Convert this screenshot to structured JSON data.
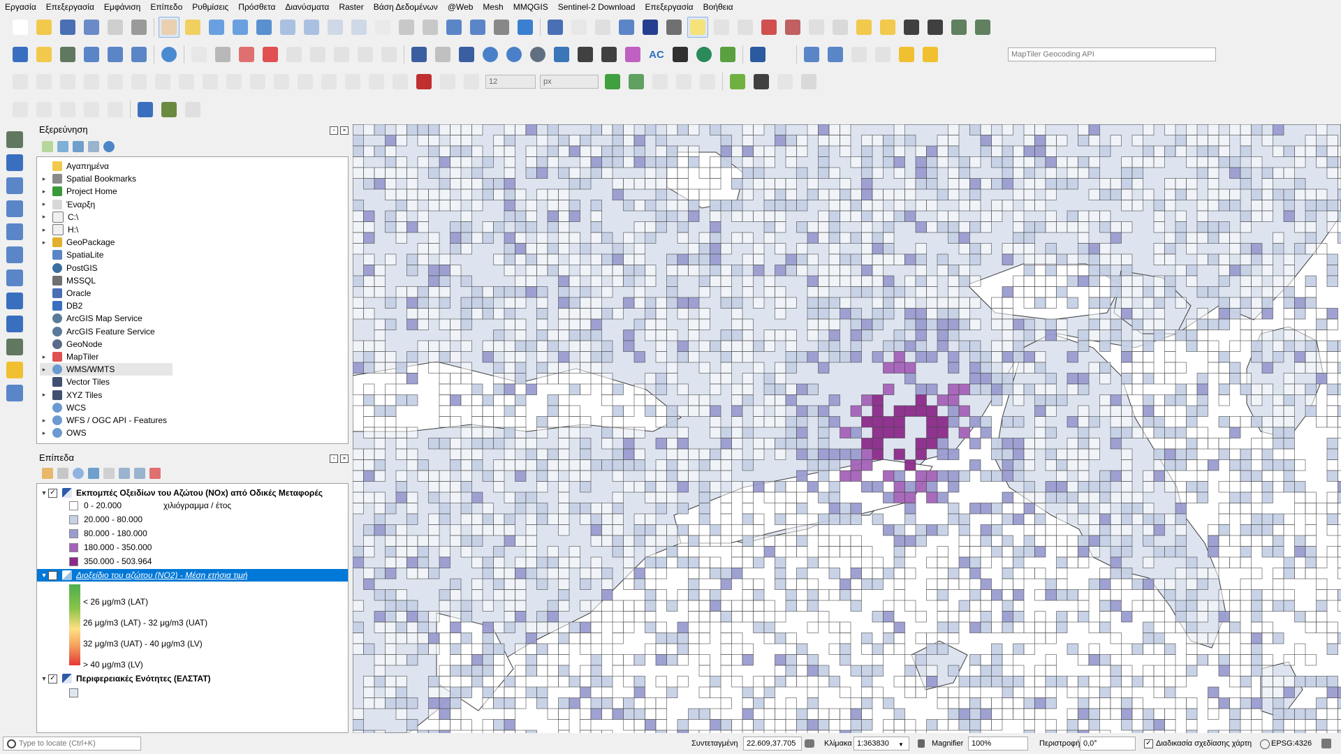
{
  "menu": [
    "Εργασία",
    "Επεξεργασία",
    "Εμφάνιση",
    "Επίπεδο",
    "Ρυθμίσεις",
    "Πρόσθετα",
    "Διανύσματα",
    "Raster",
    "Βάση Δεδομένων",
    "@Web",
    "Mesh",
    "MMQGIS",
    "Sentinel-2 Download",
    "Επεξεργασία",
    "Βοήθεια"
  ],
  "toolbar": {
    "geocoder_placeholder": "MapTiler Geocoding API",
    "font_size_value": "12",
    "font_unit_value": "px",
    "ac_label": "AC"
  },
  "browser": {
    "title": "Εξερεύνηση",
    "items": [
      {
        "label": "Αγαπημένα",
        "icon": "star-icon",
        "expand": false
      },
      {
        "label": "Spatial Bookmarks",
        "icon": "bookmark-icon",
        "expand": true
      },
      {
        "label": "Project Home",
        "icon": "home-folder-icon",
        "expand": true
      },
      {
        "label": "Έναρξη",
        "icon": "home-icon",
        "expand": true
      },
      {
        "label": "C:\\",
        "icon": "drive-icon",
        "expand": true
      },
      {
        "label": "H:\\",
        "icon": "drive-icon",
        "expand": true
      },
      {
        "label": "GeoPackage",
        "icon": "geopackage-icon",
        "expand": true
      },
      {
        "label": "SpatiaLite",
        "icon": "spatialite-icon",
        "expand": false
      },
      {
        "label": "PostGIS",
        "icon": "postgis-icon",
        "expand": false
      },
      {
        "label": "MSSQL",
        "icon": "mssql-icon",
        "expand": false
      },
      {
        "label": "Oracle",
        "icon": "oracle-icon",
        "expand": false
      },
      {
        "label": "DB2",
        "icon": "db2-icon",
        "expand": false
      },
      {
        "label": "ArcGIS Map Service",
        "icon": "arcgis-map-icon",
        "expand": false
      },
      {
        "label": "ArcGIS Feature Service",
        "icon": "arcgis-feature-icon",
        "expand": false
      },
      {
        "label": "GeoNode",
        "icon": "geonode-icon",
        "expand": false
      },
      {
        "label": "MapTiler",
        "icon": "maptiler-icon",
        "expand": true
      },
      {
        "label": "WMS/WMTS",
        "icon": "globe-icon",
        "expand": true
      },
      {
        "label": "Vector Tiles",
        "icon": "grid-icon",
        "expand": false
      },
      {
        "label": "XYZ Tiles",
        "icon": "grid-icon",
        "expand": true
      },
      {
        "label": "WCS",
        "icon": "globe-icon",
        "expand": false
      },
      {
        "label": "WFS / OGC API - Features",
        "icon": "globe-icon",
        "expand": true
      },
      {
        "label": "OWS",
        "icon": "globe-icon",
        "expand": true
      }
    ]
  },
  "layers": {
    "title": "Επίπεδα",
    "nox_layer": {
      "name": "Εκπομπές Οξειδίων του Αζώτου (NOx) από Οδικές Μεταφορές",
      "unit": "χιλιόγραμμα / έτος",
      "classes": [
        {
          "label": "0 - 20.000",
          "color": "#ffffff"
        },
        {
          "label": "20.000 - 80.000",
          "color": "#c6d1e6"
        },
        {
          "label": "80.000 - 180.000",
          "color": "#9a9cd0"
        },
        {
          "label": "180.000 - 350.000",
          "color": "#a462b8"
        },
        {
          "label": "350.000 - 503.964",
          "color": "#8b2a8a"
        }
      ]
    },
    "no2_layer": {
      "name": "Διοξείδιο του αζώτου (NO2) - Μέση ετήσια τιμή",
      "legend": [
        "< 26 μg/m3 (LAT)",
        "26 μg/m3 (LAT) - 32 μg/m3 (UAT)",
        "32 μg/m3 (UAT) - 40 μg/m3 (LV)",
        "> 40 μg/m3 (LV)"
      ]
    },
    "regions_layer": {
      "name": "Περιφερειακές Ενότητες (ΕΛΣΤΑΤ)"
    }
  },
  "status": {
    "locate_placeholder": "Type to locate (Ctrl+K)",
    "coord_label": "Συντεταγμένη",
    "coord_value": "22.609,37.705",
    "scale_label": "Κλίμακα",
    "scale_value": "1:363830",
    "magnifier_label": "Magnifier",
    "magnifier_value": "100%",
    "rotation_label": "Περιστροφή",
    "rotation_value": "0,0°",
    "render_label": "Διαδικασία σχεδίασης χάρτη",
    "crs_label": "EPSG:4326"
  }
}
